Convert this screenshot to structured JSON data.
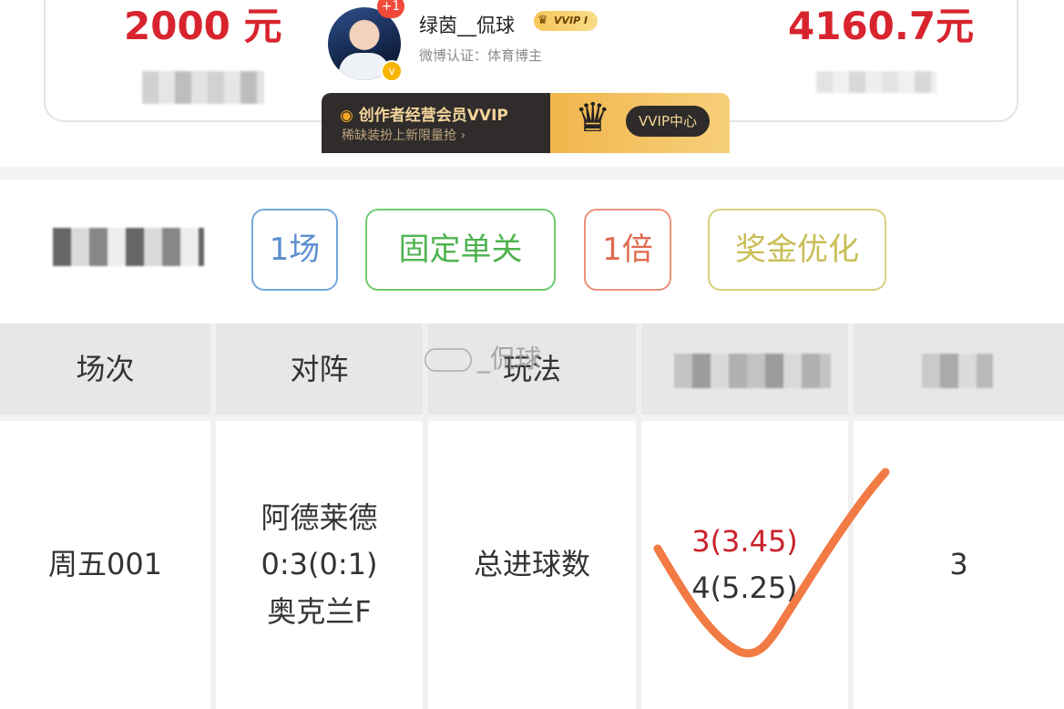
{
  "summary": {
    "left_amount": "2000 元",
    "right_amount": "4160.7元"
  },
  "profile": {
    "badge_plus": "+1",
    "name": "绿茵__侃球",
    "vvip_label": "VVIP I",
    "verified_text": "微博认证：体育博主",
    "verify_icon": "v"
  },
  "vip_banner": {
    "title": "创作者经营会员VVIP",
    "subtitle": "稀缺装扮上新限量抢 ›",
    "center_button": "VVIP中心"
  },
  "filters": {
    "matches": "1场",
    "pass_type": "固定单关",
    "multiplier": "1倍",
    "optimize": "奖金优化"
  },
  "table": {
    "headers": [
      "场次",
      "对阵",
      "玩法"
    ],
    "row": {
      "match_no": "周五001",
      "home": "阿德莱德",
      "score": "0:3(0:1)",
      "away": "奥克兰F",
      "play_type": "总进球数",
      "pick_hit": "3(3.45)",
      "pick_other": "4(5.25)",
      "result": "3"
    }
  },
  "watermark": "_侃球",
  "colors": {
    "amount_red": "#d8242e",
    "hit_red": "#c8202a",
    "check_orange": "#f27a44"
  }
}
